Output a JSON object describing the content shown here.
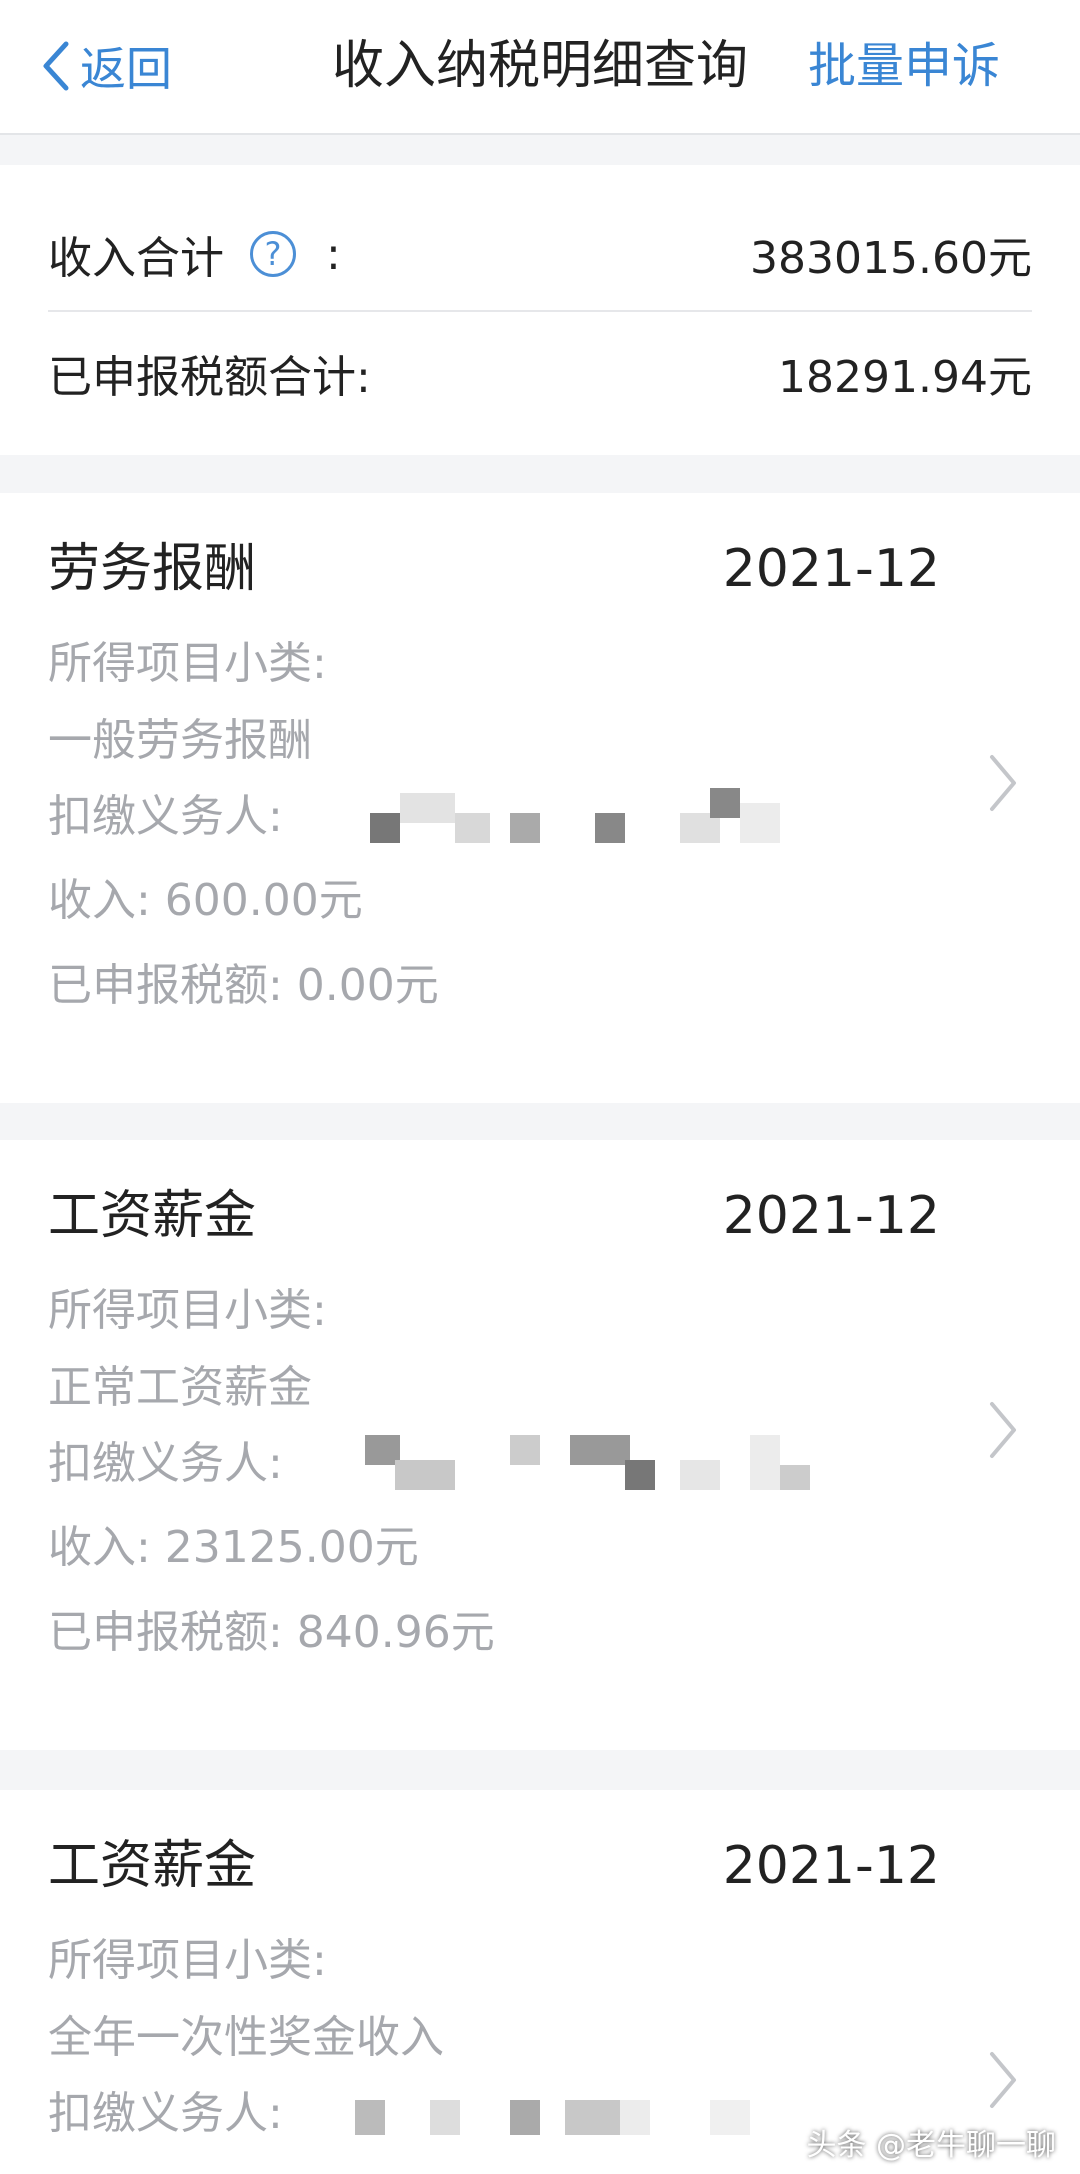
{
  "nav": {
    "back_label": "返回",
    "title": "收入纳税明细查询",
    "action_label": "批量申诉"
  },
  "summary": {
    "income_label": "收入合计",
    "income_colon": ":",
    "income_value": "383015.60元",
    "tax_label": "已申报税额合计:",
    "tax_value": "18291.94元"
  },
  "records": [
    {
      "category": "劳务报酬",
      "date": "2021-12",
      "sub_label": "所得项目小类:",
      "sub_value": "一般劳务报酬",
      "withholder_label": "扣缴义务人:",
      "income": "收入:  600.00元",
      "tax": "已申报税额:  0.00元"
    },
    {
      "category": "工资薪金",
      "date": "2021-12",
      "sub_label": "所得项目小类:",
      "sub_value": "正常工资薪金",
      "withholder_label": "扣缴义务人:",
      "income": "收入:  23125.00元",
      "tax": "已申报税额:  840.96元"
    },
    {
      "category": "工资薪金",
      "date": "2021-12",
      "sub_label": "所得项目小类:",
      "sub_value": "全年一次性奖金收入",
      "withholder_label": "扣缴义务人:"
    }
  ],
  "watermark": "头条 @老牛聊一聊",
  "colors": {
    "accent": "#3a86d4",
    "muted_text": "#a6a8ad",
    "background": "#f4f5f7"
  }
}
